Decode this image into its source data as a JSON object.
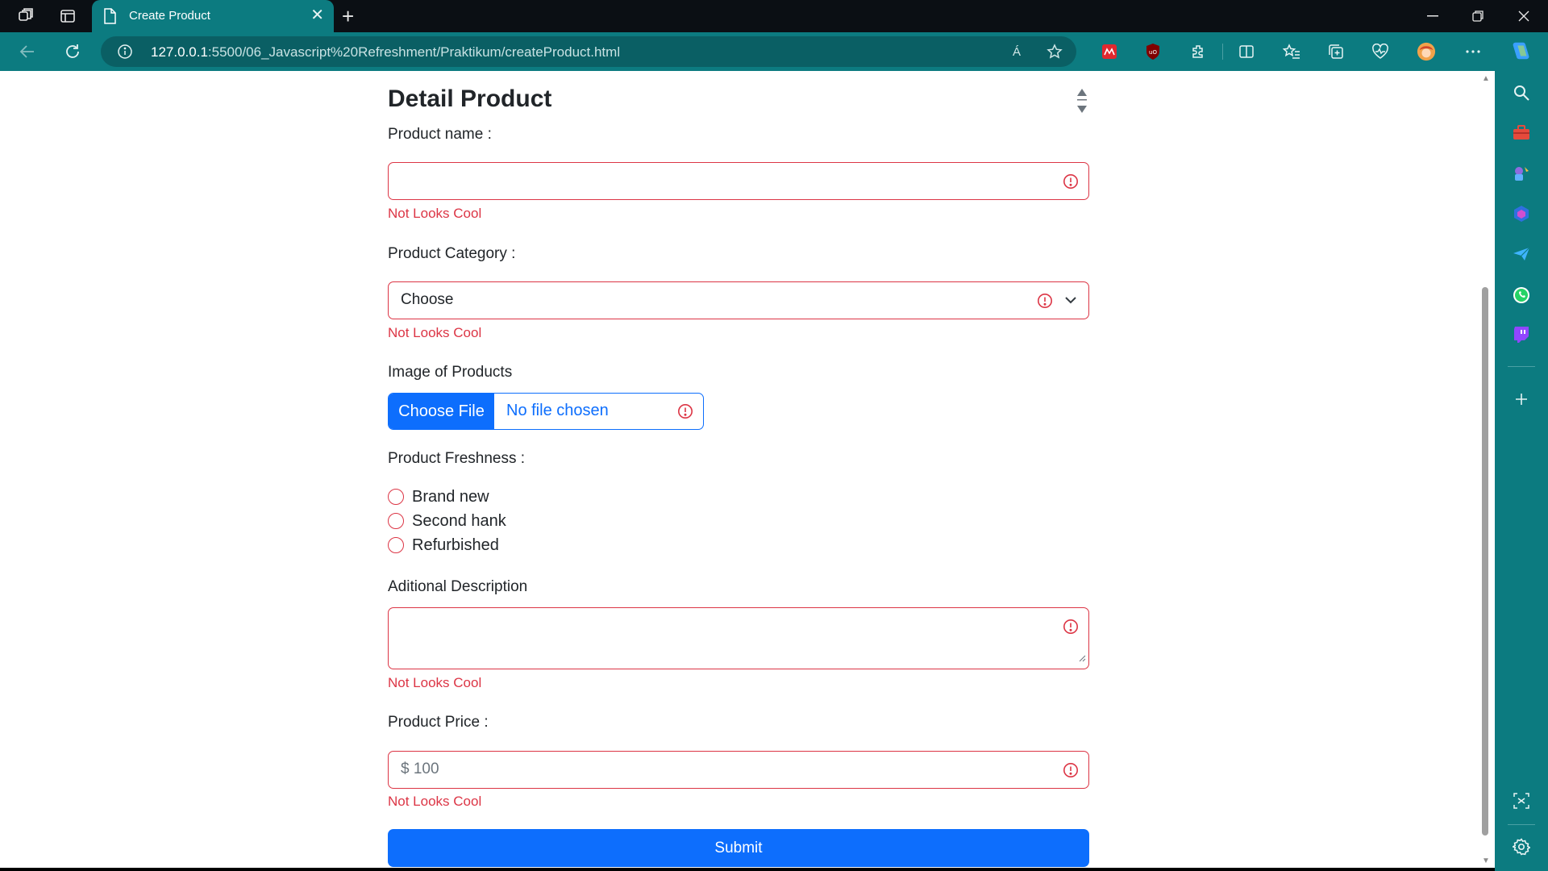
{
  "browser": {
    "tab_title": "Create Product",
    "url_host": "127.0.0.1",
    "url_rest": ":5500/06_Javascript%20Refreshment/Praktikum/createProduct.html",
    "read_aloud_label": "Á",
    "new_tab_symbol": "+",
    "close_symbol": "✕"
  },
  "form": {
    "title": "Detail Product",
    "product_name": {
      "label": "Product name :",
      "value": "",
      "error": "Not Looks Cool"
    },
    "product_category": {
      "label": "Product Category :",
      "selected": "Choose",
      "error": "Not Looks Cool"
    },
    "image": {
      "label": "Image of Products",
      "button": "Choose File",
      "status": "No file chosen"
    },
    "freshness": {
      "label": "Product Freshness :",
      "options": [
        "Brand new",
        "Second hank",
        "Refurbished"
      ]
    },
    "description": {
      "label": "Aditional Description",
      "value": "",
      "error": "Not Looks Cool"
    },
    "price": {
      "label": "Product Price :",
      "placeholder": "$ 100",
      "error": "Not Looks Cool"
    },
    "submit_label": "Submit"
  },
  "colors": {
    "accent": "#0c7b80",
    "primary": "#0d6efd",
    "danger": "#dc3545"
  }
}
